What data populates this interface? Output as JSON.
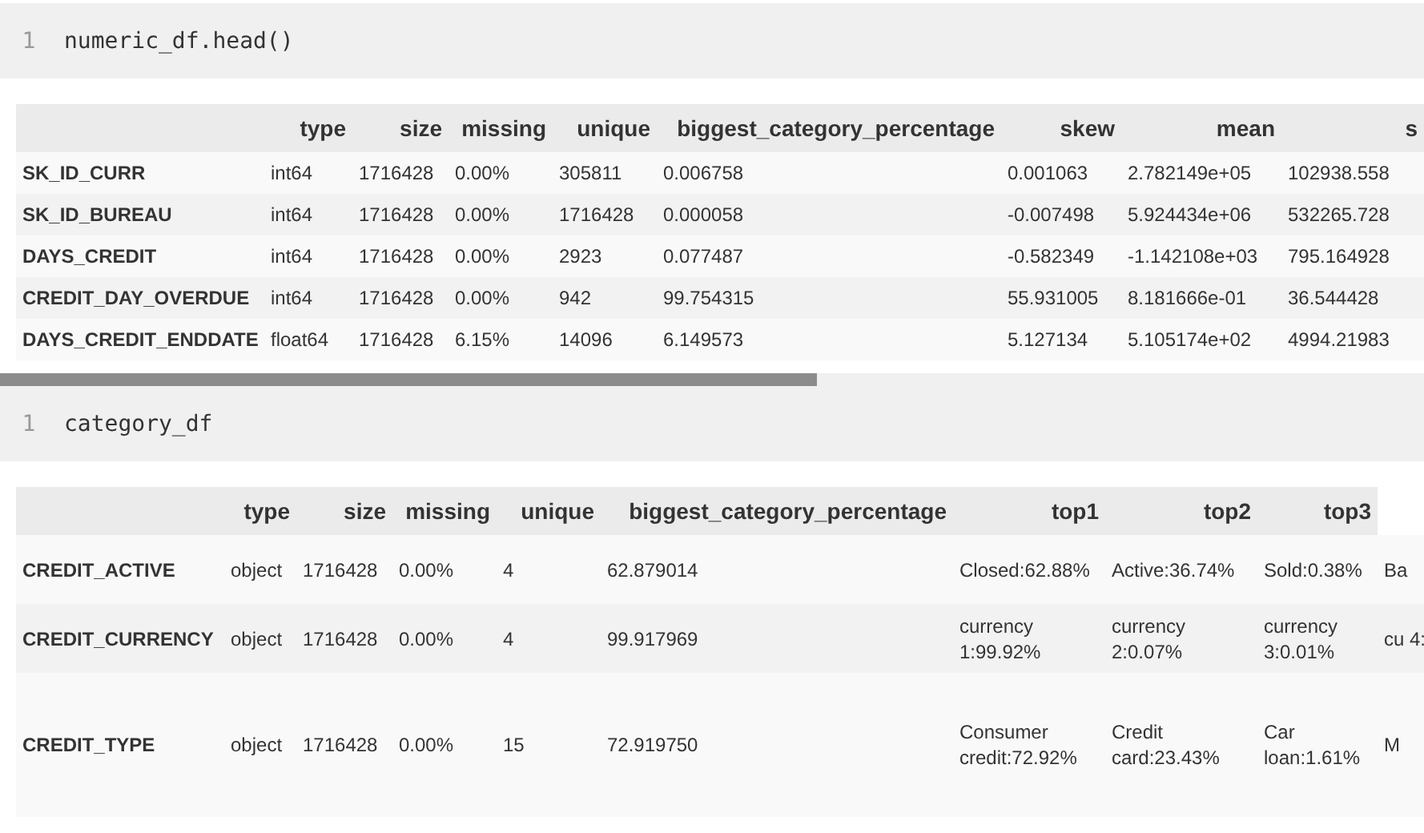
{
  "cells": [
    {
      "kind": "input",
      "prompt": "1",
      "code": "numeric_df.head()"
    },
    {
      "kind": "table",
      "horizontal_scrollbar": true,
      "headers": [
        "type",
        "size",
        "missing",
        "unique",
        "biggest_category_percentage",
        "skew",
        "mean",
        "s"
      ],
      "rows": [
        {
          "index": "SK_ID_CURR",
          "cells": [
            "int64",
            "1716428",
            "0.00%",
            "305811",
            "0.006758",
            "0.001063",
            "2.782149e+05",
            "102938.558"
          ]
        },
        {
          "index": "SK_ID_BUREAU",
          "cells": [
            "int64",
            "1716428",
            "0.00%",
            "1716428",
            "0.000058",
            "-0.007498",
            "5.924434e+06",
            "532265.728"
          ]
        },
        {
          "index": "DAYS_CREDIT",
          "cells": [
            "int64",
            "1716428",
            "0.00%",
            "2923",
            "0.077487",
            "-0.582349",
            "-1.142108e+03",
            "795.164928"
          ]
        },
        {
          "index": "CREDIT_DAY_OVERDUE",
          "cells": [
            "int64",
            "1716428",
            "0.00%",
            "942",
            "99.754315",
            "55.931005",
            "8.181666e-01",
            "36.544428"
          ]
        },
        {
          "index": "DAYS_CREDIT_ENDDATE",
          "cells": [
            "float64",
            "1716428",
            "6.15%",
            "14096",
            "6.149573",
            "5.127134",
            "5.105174e+02",
            "4994.21983"
          ]
        }
      ]
    },
    {
      "kind": "input",
      "prompt": "1",
      "code": "category_df"
    },
    {
      "kind": "table",
      "headers": [
        "type",
        "size",
        "missing",
        "unique",
        "biggest_category_percentage",
        "top1",
        "top2",
        "top3"
      ],
      "rows": [
        {
          "index": "CREDIT_ACTIVE",
          "cells": [
            "object",
            "1716428",
            "0.00%",
            "4",
            "62.879014",
            "Closed:62.88%",
            "Active:36.74%",
            "Sold:0.38%",
            "Ba"
          ]
        },
        {
          "index": "CREDIT_CURRENCY",
          "cells": [
            "object",
            "1716428",
            "0.00%",
            "4",
            "99.917969",
            "currency 1:99.92%",
            "currency 2:0.07%",
            "currency 3:0.01%",
            "cu 4:"
          ]
        },
        {
          "index": "CREDIT_TYPE",
          "cells": [
            "object",
            "1716428",
            "0.00%",
            "15",
            "72.919750",
            "Consumer credit:72.92%",
            "Credit card:23.43%",
            "Car loan:1.61%",
            "M"
          ]
        }
      ]
    }
  ]
}
